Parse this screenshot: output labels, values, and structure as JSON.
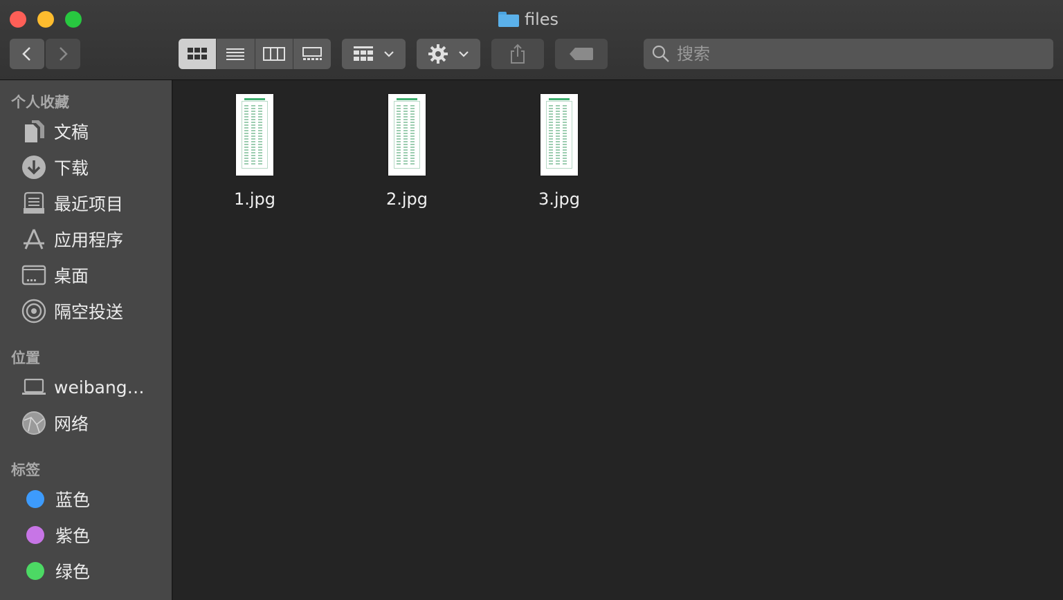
{
  "window": {
    "title": "files"
  },
  "toolbar": {
    "back_label": "‹",
    "forward_label": "›",
    "search_placeholder": "搜索"
  },
  "sidebar": {
    "favorites_header": "个人收藏",
    "favorites": [
      {
        "label": "文稿",
        "icon": "document-icon"
      },
      {
        "label": "下载",
        "icon": "download-icon"
      },
      {
        "label": "最近项目",
        "icon": "recents-icon"
      },
      {
        "label": "应用程序",
        "icon": "applications-icon"
      },
      {
        "label": "桌面",
        "icon": "desktop-icon"
      },
      {
        "label": "隔空投送",
        "icon": "airdrop-icon"
      }
    ],
    "locations_header": "位置",
    "locations": [
      {
        "label": "weibang…",
        "icon": "laptop-icon"
      },
      {
        "label": "网络",
        "icon": "network-icon"
      }
    ],
    "tags_header": "标签",
    "tags": [
      {
        "label": "蓝色",
        "color": "#3d9bfc"
      },
      {
        "label": "紫色",
        "color": "#c775e6"
      },
      {
        "label": "绿色",
        "color": "#4cd964"
      }
    ]
  },
  "files": [
    {
      "name": "1.jpg"
    },
    {
      "name": "2.jpg"
    },
    {
      "name": "3.jpg"
    }
  ]
}
